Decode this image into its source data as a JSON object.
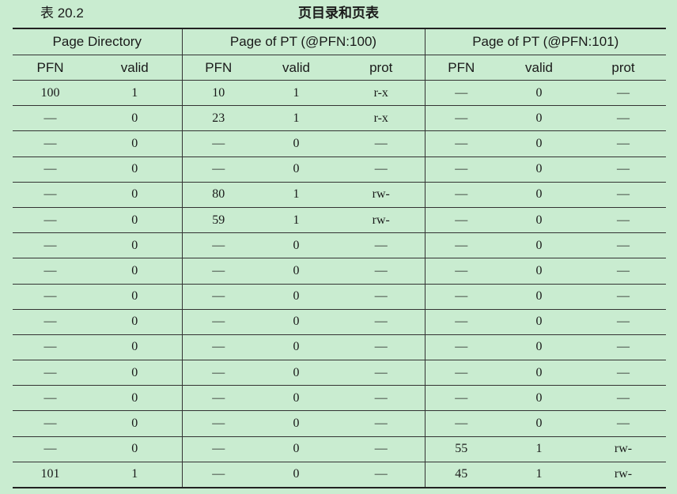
{
  "caption": {
    "number": "表 20.2",
    "title": "页目录和页表"
  },
  "groups": [
    "Page Directory",
    "Page of PT (@PFN:100)",
    "Page of PT (@PFN:101)"
  ],
  "columns": [
    "PFN",
    "valid",
    "PFN",
    "valid",
    "prot",
    "PFN",
    "valid",
    "prot"
  ],
  "rows": [
    [
      "100",
      "1",
      "10",
      "1",
      "r-x",
      "—",
      "0",
      "—"
    ],
    [
      "—",
      "0",
      "23",
      "1",
      "r-x",
      "—",
      "0",
      "—"
    ],
    [
      "—",
      "0",
      "—",
      "0",
      "—",
      "—",
      "0",
      "—"
    ],
    [
      "—",
      "0",
      "—",
      "0",
      "—",
      "—",
      "0",
      "—"
    ],
    [
      "—",
      "0",
      "80",
      "1",
      "rw-",
      "—",
      "0",
      "—"
    ],
    [
      "—",
      "0",
      "59",
      "1",
      "rw-",
      "—",
      "0",
      "—"
    ],
    [
      "—",
      "0",
      "—",
      "0",
      "—",
      "—",
      "0",
      "—"
    ],
    [
      "—",
      "0",
      "—",
      "0",
      "—",
      "—",
      "0",
      "—"
    ],
    [
      "—",
      "0",
      "—",
      "0",
      "—",
      "—",
      "0",
      "—"
    ],
    [
      "—",
      "0",
      "—",
      "0",
      "—",
      "—",
      "0",
      "—"
    ],
    [
      "—",
      "0",
      "—",
      "0",
      "—",
      "—",
      "0",
      "—"
    ],
    [
      "—",
      "0",
      "—",
      "0",
      "—",
      "—",
      "0",
      "—"
    ],
    [
      "—",
      "0",
      "—",
      "0",
      "—",
      "—",
      "0",
      "—"
    ],
    [
      "—",
      "0",
      "—",
      "0",
      "—",
      "—",
      "0",
      "—"
    ],
    [
      "—",
      "0",
      "—",
      "0",
      "—",
      "55",
      "1",
      "rw-"
    ],
    [
      "101",
      "1",
      "—",
      "0",
      "—",
      "45",
      "1",
      "rw-"
    ]
  ]
}
